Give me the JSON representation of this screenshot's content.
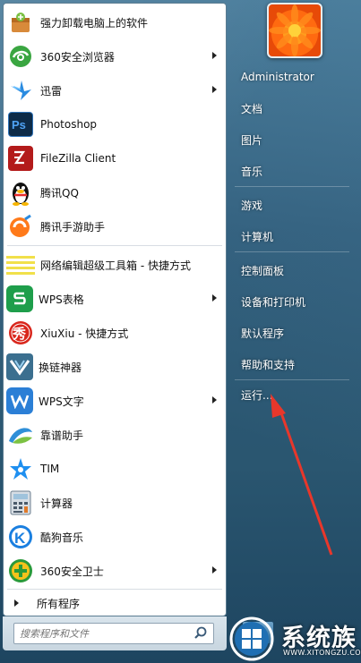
{
  "programs": [
    {
      "label": "强力卸载电脑上的软件",
      "icon": "uninstall-box-icon",
      "submenu": false
    },
    {
      "label": "360安全浏览器",
      "icon": "360-browser-icon",
      "submenu": true
    },
    {
      "label": "迅雷",
      "icon": "thunder-icon",
      "submenu": true
    },
    {
      "label": "Photoshop",
      "icon": "photoshop-icon",
      "submenu": false
    },
    {
      "label": "FileZilla Client",
      "icon": "filezilla-icon",
      "submenu": false
    },
    {
      "label": "腾讯QQ",
      "icon": "qq-penguin-icon",
      "submenu": false
    },
    {
      "label": "腾讯手游助手",
      "icon": "tencent-game-assistant-icon",
      "submenu": false
    },
    {
      "label": "网络编辑超级工具箱 - 快捷方式",
      "icon": "toolbox-icon",
      "submenu": false
    },
    {
      "label": "WPS表格",
      "icon": "wps-sheet-icon",
      "submenu": true
    },
    {
      "label": "XiuXiu - 快捷方式",
      "icon": "xiuxiu-icon",
      "submenu": false
    },
    {
      "label": "换链神器",
      "icon": "link-tool-icon",
      "submenu": false
    },
    {
      "label": "WPS文字",
      "icon": "wps-writer-icon",
      "submenu": true
    },
    {
      "label": "靠谱助手",
      "icon": "kaopu-icon",
      "submenu": false
    },
    {
      "label": "TIM",
      "icon": "tim-star-icon",
      "submenu": false
    },
    {
      "label": "计算器",
      "icon": "calculator-icon",
      "submenu": false
    },
    {
      "label": "酷狗音乐",
      "icon": "kugou-icon",
      "submenu": false
    },
    {
      "label": "360安全卫士",
      "icon": "360-safe-icon",
      "submenu": true
    }
  ],
  "all_programs_label": "所有程序",
  "search": {
    "placeholder": "搜索程序和文件"
  },
  "right_menu": [
    {
      "label": "Administrator"
    },
    {
      "label": "文档"
    },
    {
      "label": "图片"
    },
    {
      "label": "音乐"
    },
    {
      "label": "游戏"
    },
    {
      "label": "计算机"
    },
    {
      "label": "控制面板"
    },
    {
      "label": "设备和打印机"
    },
    {
      "label": "默认程序"
    },
    {
      "label": "帮助和支持"
    },
    {
      "label": "运行..."
    }
  ],
  "watermark": {
    "title": "系统族",
    "url": "WWW.XITONGZU.COM"
  },
  "colors": {
    "annotation_arrow": "#e8372b",
    "panel_bg": "#2d5a78"
  }
}
